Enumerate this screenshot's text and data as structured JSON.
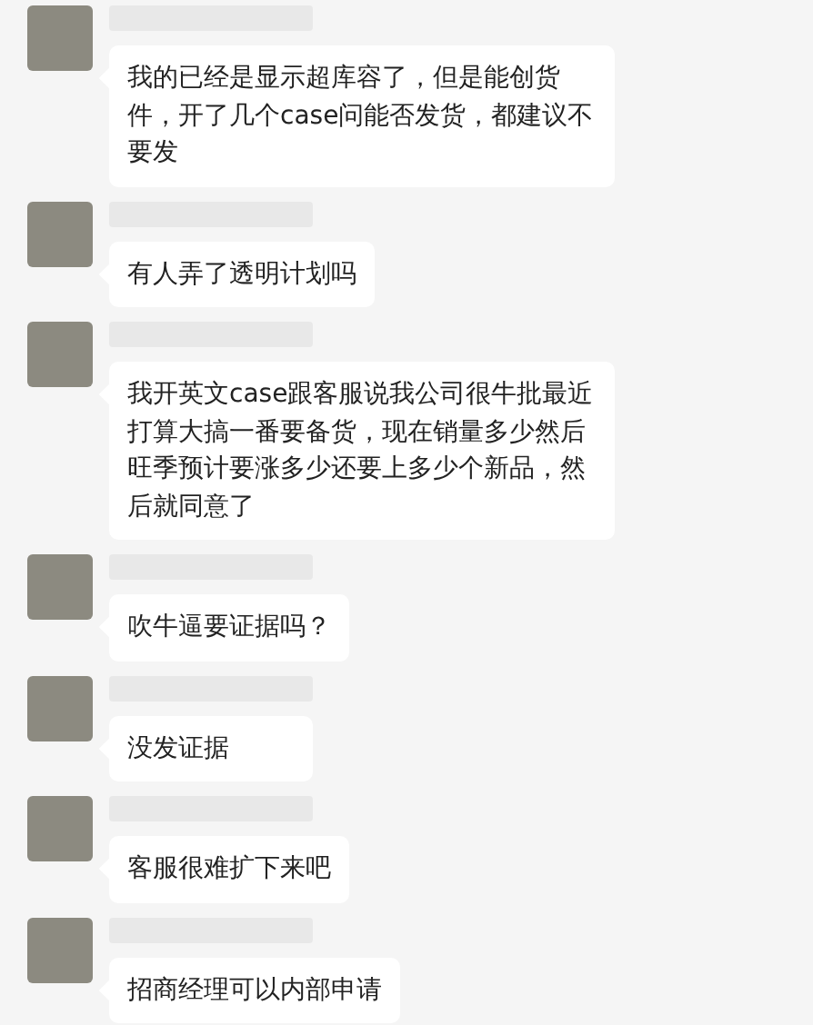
{
  "messages": [
    {
      "text": "我的已经是显示超库容了，但是能创货件，开了几个case问能否发货，都建议不要发"
    },
    {
      "text": "有人弄了透明计划吗"
    },
    {
      "text": "我开英文case跟客服说我公司很牛批最近打算大搞一番要备货，现在销量多少然后旺季预计要涨多少还要上多少个新品，然后就同意了"
    },
    {
      "text": "吹牛逼要证据吗？"
    },
    {
      "text": "没发证据"
    },
    {
      "text": "客服很难扩下来吧"
    },
    {
      "text": "招商经理可以内部申请"
    }
  ]
}
